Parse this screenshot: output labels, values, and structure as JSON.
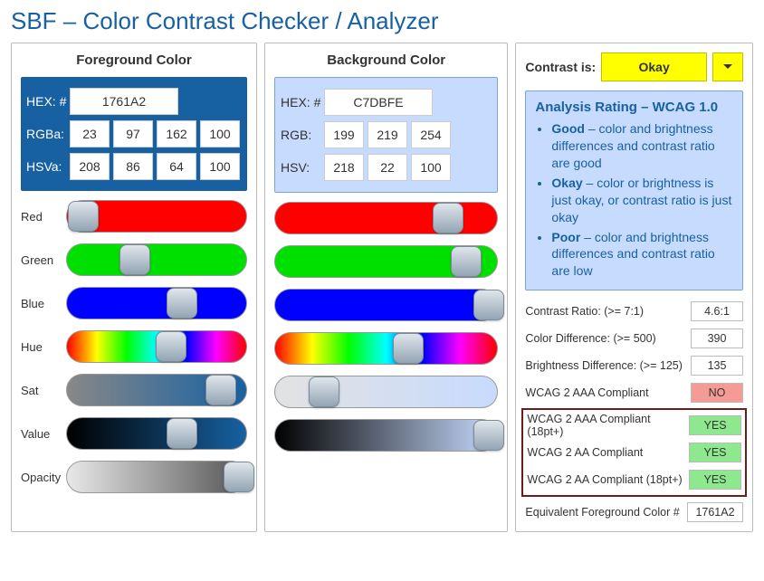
{
  "title": "SBF – Color Contrast Checker / Analyzer",
  "fg": {
    "heading": "Foreground Color",
    "hex_label": "HEX: #",
    "hex": "1761A2",
    "rgb_label": "RGBa:",
    "r": "23",
    "g": "97",
    "b": "162",
    "a": "100",
    "hsv_label": "HSVa:",
    "h": "208",
    "s": "86",
    "v": "64",
    "va": "100",
    "box_bg": "#1761a2",
    "sliders": {
      "red": {
        "label": "Red",
        "pos": 9
      },
      "green": {
        "label": "Green",
        "pos": 38
      },
      "blue": {
        "label": "Blue",
        "pos": 64
      },
      "hue": {
        "label": "Hue",
        "pos": 58
      },
      "sat": {
        "label": "Sat",
        "pos": 86
      },
      "val": {
        "label": "Value",
        "pos": 64
      },
      "op": {
        "label": "Opacity",
        "pos": 96
      }
    }
  },
  "bg": {
    "heading": "Background Color",
    "hex_label": "HEX: #",
    "hex": "C7DBFE",
    "rgb_label": "RGB:",
    "r": "199",
    "g": "219",
    "b": "254",
    "hsv_label": "HSV:",
    "h": "218",
    "s": "22",
    "v": "100",
    "box_bg": "#c7dbfe",
    "sliders": {
      "red": {
        "pos": 78
      },
      "green": {
        "pos": 86
      },
      "blue": {
        "pos": 96
      },
      "hue": {
        "pos": 60
      },
      "sat": {
        "pos": 22
      },
      "val": {
        "pos": 96
      }
    }
  },
  "results": {
    "contrast_label": "Contrast is:",
    "contrast_value": "Okay",
    "rating": {
      "title": "Analysis Rating – WCAG 1.0",
      "good_term": "Good",
      "good_text": " – color and brightness differences and contrast ratio are good",
      "okay_term": "Okay",
      "okay_text": " – color or brightness is just okay, or contrast ratio is just okay",
      "poor_term": "Poor",
      "poor_text": " – color and brightness differences and contrast ratio are low"
    },
    "metrics": {
      "ratio_label": "Contrast Ratio: (>= 7:1)",
      "ratio_val": "4.6:1",
      "cdiff_label": "Color Difference: (>= 500)",
      "cdiff_val": "390",
      "bdiff_label": "Brightness Difference: (>= 125)",
      "bdiff_val": "135",
      "aaa_label": "WCAG 2 AAA Compliant",
      "aaa_val": "NO",
      "aaa18_label": "WCAG 2 AAA Compliant (18pt+)",
      "aaa18_val": "YES",
      "aa_label": "WCAG 2 AA Compliant",
      "aa_val": "YES",
      "aa18_label": "WCAG 2 AA Compliant (18pt+)",
      "aa18_val": "YES",
      "eq_label": "Equivalent Foreground Color #",
      "eq_val": "1761A2"
    }
  }
}
